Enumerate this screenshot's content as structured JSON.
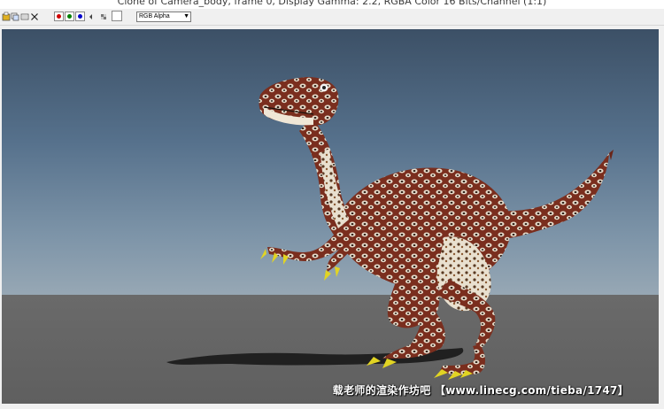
{
  "window": {
    "title": "Clone of Camera_body, frame 0, Display Gamma: 2.2, RGBA Color 16 Bits/Channel (1:1)"
  },
  "toolbar": {
    "channel_select_value": "RGB Alpha",
    "icons": [
      "save-image-icon",
      "clone-window-icon",
      "copy-icon",
      "clear-icon",
      "red-channel-icon",
      "green-channel-icon",
      "blue-channel-icon",
      "mono-icon",
      "swatch-icon"
    ],
    "channel_colors": {
      "red": "#d00000",
      "green": "#008000",
      "blue": "#0000cc"
    }
  },
  "render": {
    "subject": "raptor dinosaur with snake-skin texture",
    "watermark": "载老师的渲染作坊吧 【www.linecg.com/tieba/1747】"
  },
  "colors": {
    "sky_top": "#3c5066",
    "sky_horizon": "#a0aab2",
    "ground": "#666666"
  }
}
